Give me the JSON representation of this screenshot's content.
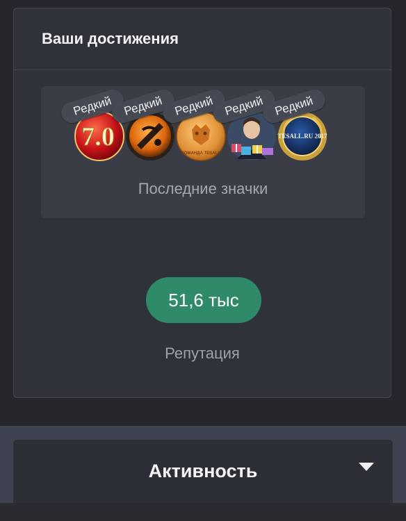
{
  "achievements": {
    "title": "Ваши достижения",
    "badges": [
      {
        "name": "badge-version-7",
        "text": "7.0",
        "tag": "Редкий"
      },
      {
        "name": "badge-orange-emblem",
        "text": "",
        "tag": "Редкий"
      },
      {
        "name": "badge-team-tesall",
        "text": "КОМАНДА TESALL",
        "tag": "Редкий"
      },
      {
        "name": "badge-portrait-gifts",
        "text": "",
        "tag": "Редкий"
      },
      {
        "name": "badge-tesall-2017",
        "text": "TESALL.RU 2017",
        "tag": "Редкий"
      }
    ],
    "badges_caption": "Последние значки"
  },
  "reputation": {
    "value": "51,6 тыс",
    "label": "Репутация"
  },
  "activity": {
    "title": "Активность",
    "chevron_icon": "chevron-down-icon"
  }
}
